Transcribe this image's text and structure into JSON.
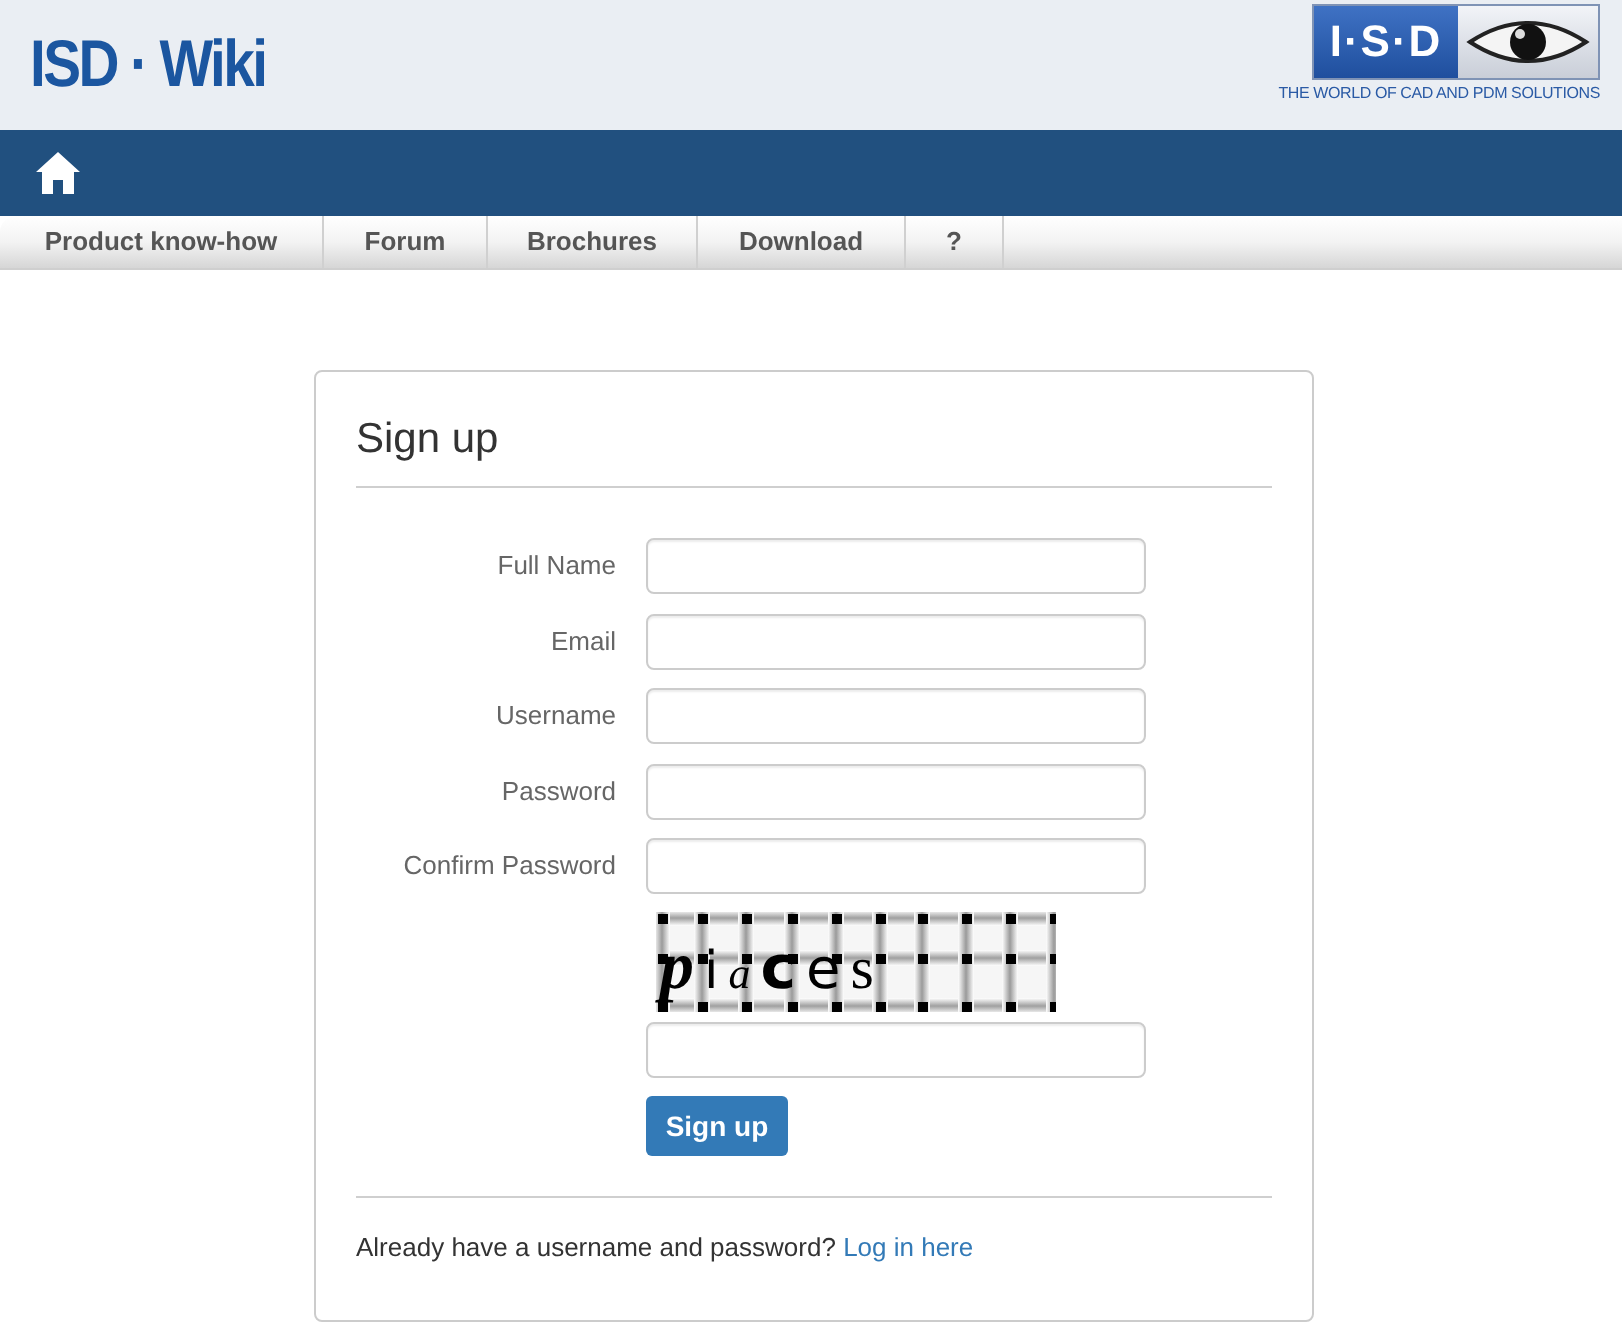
{
  "header": {
    "site_title": "ISD · Wiki",
    "logo": {
      "mark": "I·S·D",
      "tagline": "THE WORLD OF CAD AND PDM SOLUTIONS"
    }
  },
  "nav": {
    "tabs": [
      {
        "label": "Product know-how",
        "selected": false
      },
      {
        "label": "Forum",
        "selected": false
      },
      {
        "label": "Brochures",
        "selected": false
      },
      {
        "label": "Download",
        "selected": false
      },
      {
        "label": "?",
        "selected": false
      }
    ]
  },
  "form": {
    "title": "Sign up",
    "fields": [
      {
        "label": "Full Name"
      },
      {
        "label": "Email"
      },
      {
        "label": "Username"
      },
      {
        "label": "Password"
      },
      {
        "label": "Confirm Password"
      }
    ],
    "captcha": {
      "text": "piaces"
    },
    "submit": "Sign up",
    "footer": {
      "text": "Already have a username and password?",
      "link": "Log in here"
    }
  }
}
